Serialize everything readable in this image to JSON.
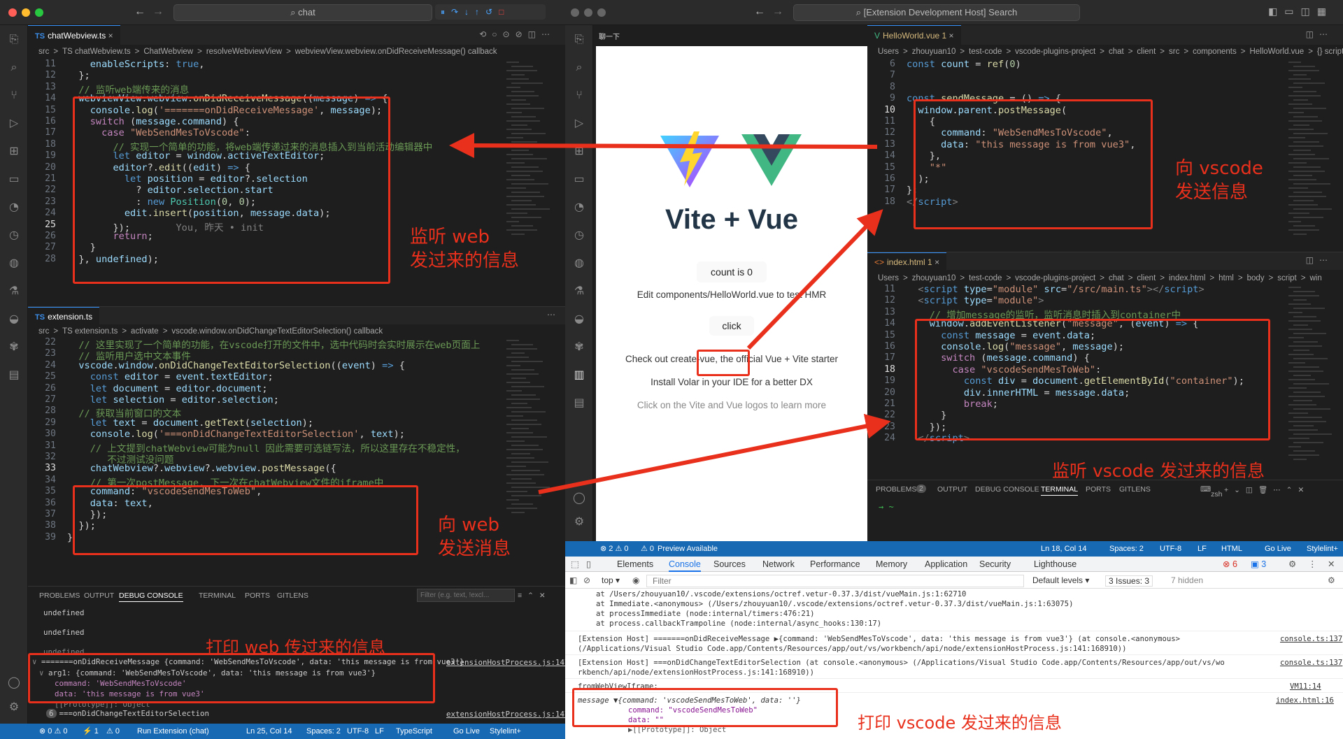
{
  "left": {
    "search": "chat",
    "tab1": "chatWebview.ts",
    "crumb1": [
      "src",
      ">",
      "TS chatWebview.ts",
      ">",
      "ChatWebview",
      ">",
      "resolveWebviewView",
      ">",
      "webviewView.webview.onDidReceiveMessage() callback"
    ],
    "tab2": "extension.ts",
    "crumb2": [
      "src",
      ">",
      "TS extension.ts",
      ">",
      "activate",
      ">",
      "vscode.window.onDidChangeTextEditorSelection() callback"
    ],
    "panel_tabs": [
      "PROBLEMS",
      "OUTPUT",
      "DEBUG CONSOLE",
      "TERMINAL",
      "PORTS",
      "GITLENS"
    ],
    "filter_placeholder": "Filter (e.g. text, !excl...",
    "console": [
      "undefined",
      "undefined",
      "undefined"
    ],
    "console_log1": "=======onDidReceiveMessage {command: 'WebSendMesToVscode', data: 'this message is from vue3'}",
    "console_src1": "extensionHostProcess.js:147",
    "console_arg": "arg1: {command: 'WebSendMesToVscode', data: 'this message is from vue3'}",
    "console_cmd": "command: 'WebSendMesToVscode'",
    "console_data": "data: 'this message is from vue3'",
    "console_proto": "[[Prototype]]: Object",
    "console_log2": "===onDidChangeTextEditorSelection",
    "console_count": "6",
    "console_src2": "extensionHostProcess.js:147",
    "status": [
      "⊗ 0 ⚠ 0",
      "⚡ 1",
      "⚠ 0",
      "Run Extension (chat)",
      "Ln 25, Col 14",
      "Spaces: 2",
      "UTF-8",
      "LF",
      "TypeScript",
      "Go Live",
      "Stylelint+"
    ]
  },
  "right": {
    "search": "[Extension Development Host] Search",
    "web_tab": "聊一下",
    "title": "Vite + Vue",
    "count_btn": "count is 0",
    "edit_text": "Edit components/HelloWorld.vue to test HMR",
    "click_btn": "click",
    "check_text": "Check out create-vue, the official Vue + Vite starter",
    "install_text": "Install Volar in your IDE for a better DX",
    "learn_text": "Click on the Vite and Vue logos to learn more",
    "tab1": "HelloWorld.vue 1",
    "crumb1": [
      "Users",
      ">",
      "zhouyuan10",
      ">",
      "test-code",
      ">",
      "vscode-plugins-project",
      ">",
      "chat",
      ">",
      "client",
      ">",
      "src",
      ">",
      "components",
      ">",
      "HelloWorld.vue",
      ">",
      "{} script setup"
    ],
    "tab2": "index.html 1",
    "crumb2": [
      "Users",
      ">",
      "zhouyuan10",
      ">",
      "test-code",
      ">",
      "vscode-plugins-project",
      ">",
      "chat",
      ">",
      "client",
      ">",
      "index.html",
      ">",
      "html",
      ">",
      "body",
      ">",
      "script",
      ">",
      "win"
    ],
    "panel_tabs": [
      "PROBLEMS",
      "2",
      "OUTPUT",
      "DEBUG CONSOLE",
      "TERMINAL",
      "PORTS",
      "GITLENS"
    ],
    "shell": "zsh",
    "prompt": "→ ~",
    "status": [
      "⊗ 2 ⚠ 0",
      "⚠ 0",
      "Preview Available",
      "Ln 18, Col 14",
      "Spaces: 2",
      "UTF-8",
      "LF",
      "HTML",
      "Go Live",
      "Stylelint+"
    ],
    "devtools_tabs": [
      "Elements",
      "Console",
      "Sources",
      "Network",
      "Performance",
      "Memory",
      "Application",
      "Security",
      "Lighthouse"
    ],
    "errors": "6",
    "messages": "3",
    "top": "top",
    "filter": "Filter",
    "levels": "Default levels ▾",
    "issues": "3 Issues: 3",
    "hidden": "7 hidden",
    "stack": [
      "at /Users/zhouyuan10/.vscode/extensions/octref.vetur-0.37.3/dist/vueMain.js:1:62710",
      "at Immediate.<anonymous> (/Users/zhouyuan10/.vscode/extensions/octref.vetur-0.37.3/dist/vueMain.js:1:63075)",
      "at processImmediate (node:internal/timers:476:21)",
      "at process.callbackTrampoline (node:internal/async_hooks:130:17)"
    ],
    "log1a": "[Extension Host] =======onDidReceiveMessage ▶{command: 'WebSendMesToVscode', data: 'this message is from vue3'} (at console.<anonymous>",
    "log1b": "(/Applications/Visual Studio Code.app/Contents/Resources/app/out/vs/workbench/api/node/extensionHostProcess.js:141:168910))",
    "log1src": "console.ts:137",
    "log2a": "[Extension Host] ===onDidChangeTextEditorSelection  (at console.<anonymous> (/Applications/Visual Studio Code.app/Contents/Resources/app/out/vs/wo",
    "log2b": "rkbench/api/node/extensionHostProcess.js:141:168910))",
    "log2src": "console.ts:137",
    "log3": "fromWebViewIframe:",
    "log3src": "VM11:14",
    "log4a": "message ▼{command: 'vscodeSendMesToWeb', data: ''}",
    "log4src": "index.html:16",
    "log4b": "command: \"vscodeSendMesToWeb\"",
    "log4c": "data: \"\"",
    "log4d": "▶[[Prototype]]: Object"
  },
  "annotations": {
    "a1": "监听 web\n发过来的信息",
    "a2": "向 web\n发送消息",
    "a3": "打印 web 传过来的信息",
    "a4": "向 vscode\n发送信息",
    "a5": "监听 vscode 发过来的信息",
    "a6": "打印 vscode 发过来的信息"
  },
  "colors": {
    "annotation": "#e8301c",
    "statusbar": "#1769b3",
    "editor_bg": "#1e1e1e"
  }
}
